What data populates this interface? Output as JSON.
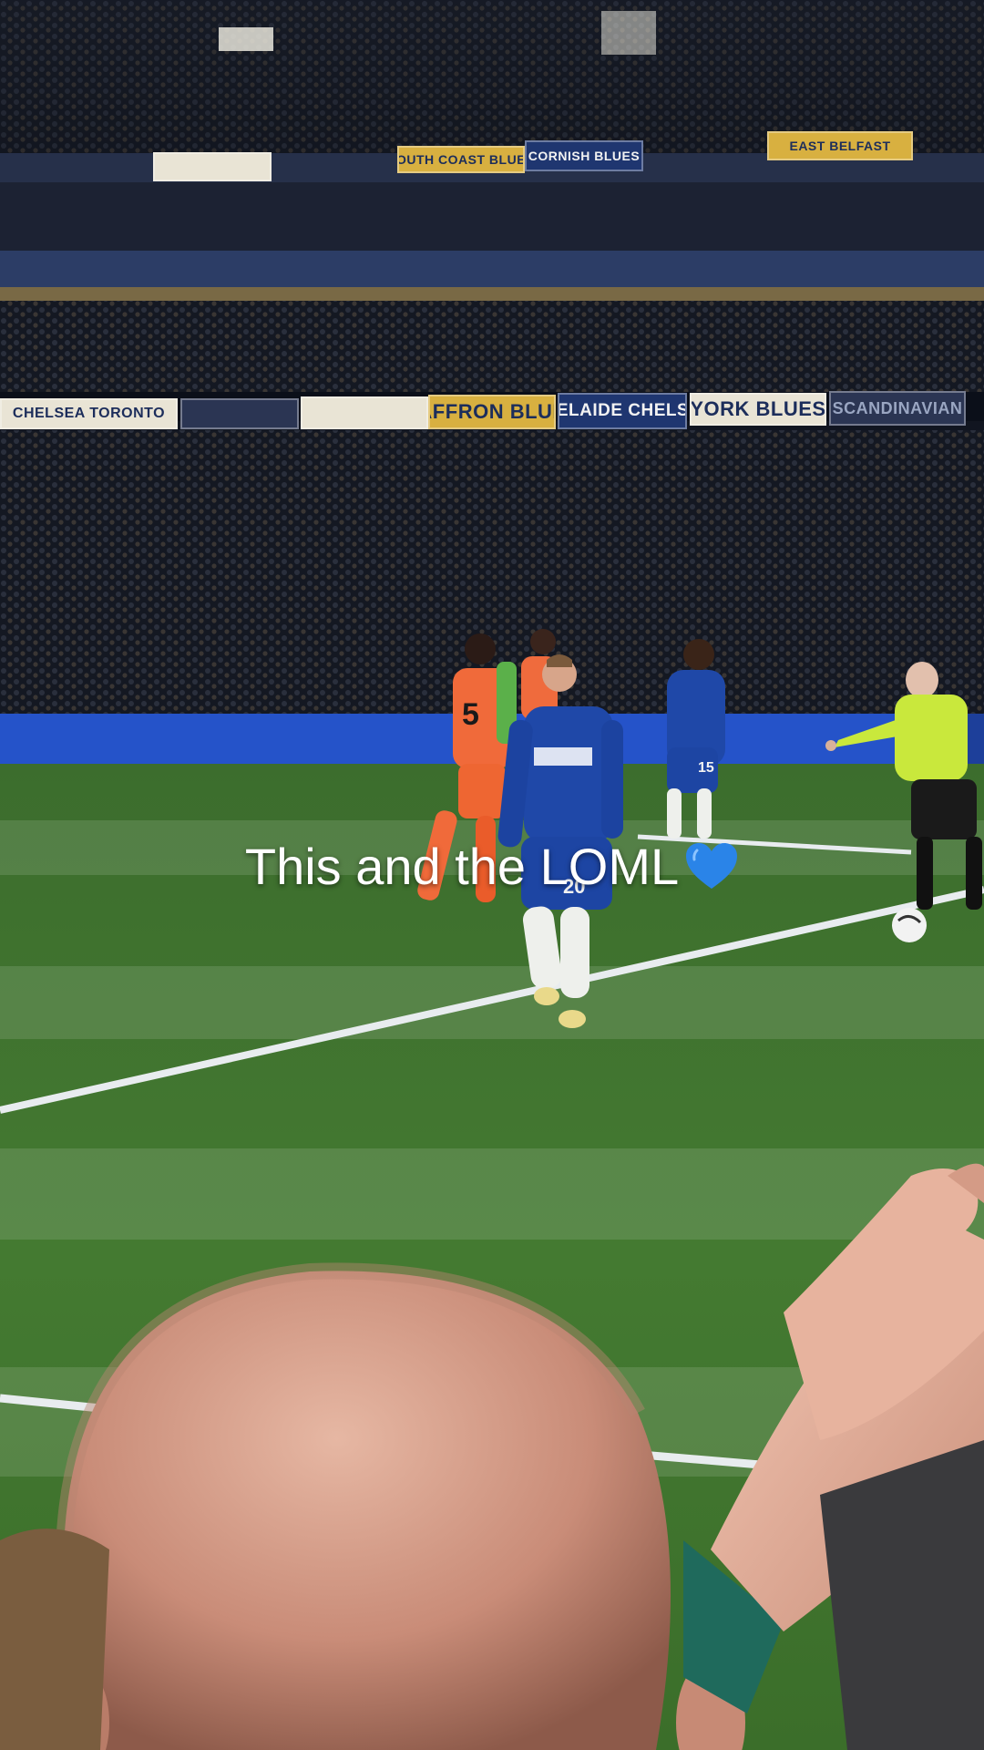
{
  "caption": {
    "text": "This and the LOML",
    "emoji_icon": "blue-heart-icon"
  },
  "stands": {
    "upper_banners": [
      "SOUTH COAST BLUES",
      "CORNISH BLUES",
      "EAST BELFAST"
    ],
    "lower_banners": [
      "CHELSEA TORONTO",
      "SAFFRON BLUES",
      "ADELAIDE CHELSEA",
      "YORK BLUES",
      "SCANDINAVIAN"
    ]
  },
  "players": {
    "keeper_number": "5",
    "center_number": "20",
    "right_number": "15"
  },
  "colors": {
    "pitch": "#3f7a2c",
    "chelsea_kit": "#1f48a8",
    "keeper_kit": "#f06a3a",
    "referee_kit": "#c9e83c",
    "ad_board_blue": "#2553c9"
  }
}
